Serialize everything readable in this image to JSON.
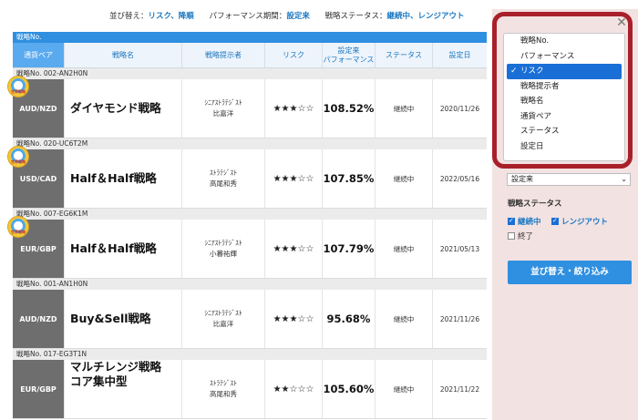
{
  "topbar": {
    "sort_label": "並び替え：",
    "sort_value": "リスク、降順",
    "period_label": "パフォーマンス期間：",
    "period_value": "設定来",
    "status_label": "戦略ステータス：",
    "status_value": "継続中、レンジアウト"
  },
  "table": {
    "group_header": "戦略No.",
    "columns": {
      "pair": "通貨ペア",
      "name": "戦略名",
      "provider": "戦略提示者",
      "risk": "リスク",
      "perf_line1": "設定来",
      "perf_line2": "パフォーマンス",
      "status": "ステータス",
      "date": "設定日"
    },
    "rows": [
      {
        "id": "戦略No. 002-AN2H0N",
        "pair": "AUD/NZD",
        "name1": "ダイヤモンド戦略",
        "name2": "",
        "prov1": "ｼﾆｱｽﾄﾗﾃｼﾞｽﾄ",
        "prov2": "比嘉洋",
        "risk": "★★★☆☆",
        "perf": "108.52%",
        "status": "継続中",
        "date": "2020/11/26",
        "badge": "世界戦略"
      },
      {
        "id": "戦略No. 020-UC6T2M",
        "pair": "USD/CAD",
        "name1": "Half＆Half戦略",
        "name2": "",
        "prov1": "ｽﾄﾗﾃｼﾞｽﾄ",
        "prov2": "高尾和秀",
        "risk": "★★★☆☆",
        "perf": "107.85%",
        "status": "継続中",
        "date": "2022/05/16",
        "badge": "世界戦略"
      },
      {
        "id": "戦略No. 007-EG6K1M",
        "pair": "EUR/GBP",
        "name1": "Half＆Half戦略",
        "name2": "",
        "prov1": "ｼﾆｱｽﾄﾗﾃｼﾞｽﾄ",
        "prov2": "小暮祐輝",
        "risk": "★★★☆☆",
        "perf": "107.79%",
        "status": "継続中",
        "date": "2021/05/13",
        "badge": "世界戦略"
      },
      {
        "id": "戦略No. 001-AN1H0N",
        "pair": "AUD/NZD",
        "name1": "Buy&Sell戦略",
        "name2": "",
        "prov1": "ｼﾆｱｽﾄﾗﾃｼﾞｽﾄ",
        "prov2": "比嘉洋",
        "risk": "★★★☆☆",
        "perf": "95.68%",
        "status": "継続中",
        "date": "2021/11/26",
        "badge": ""
      },
      {
        "id": "戦略No. 017-EG3T1N",
        "pair": "EUR/GBP",
        "name1": "マルチレンジ戦略",
        "name2": "コア集中型",
        "prov1": "ｽﾄﾗﾃｼﾞｽﾄ",
        "prov2": "高尾和秀",
        "risk": "★★☆☆☆",
        "perf": "105.60%",
        "status": "継続中",
        "date": "2021/11/22",
        "badge": ""
      }
    ]
  },
  "panel": {
    "close_glyph": "✕",
    "sort_options": [
      "戦略No.",
      "パフォーマンス",
      "リスク",
      "戦略提示者",
      "戦略名",
      "通貨ペア",
      "ステータス",
      "設定日"
    ],
    "selected_sort": "リスク",
    "period_select": "設定来",
    "status_title": "戦略ステータス",
    "status_continuing": "継続中",
    "status_rangeout": "レンジアウト",
    "status_ended": "終了",
    "apply_button": "並び替え・絞り込み"
  },
  "colors": {
    "accent": "#2f8fe0",
    "highlight_ring": "#a8202a",
    "panel_bg": "#f3e2e2"
  }
}
